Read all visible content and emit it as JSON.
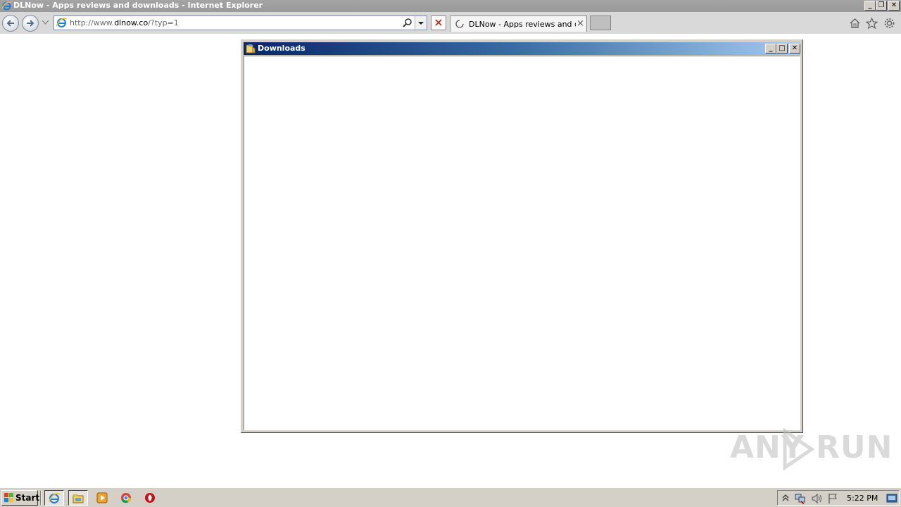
{
  "browser": {
    "window_title": "DLNow - Apps reviews and downloads - Internet Explorer",
    "address": {
      "prefix": "http://www.",
      "domain": "dlnow.co",
      "suffix": "/?typ=1"
    },
    "tab_title": "DLNow - Apps reviews and d...",
    "window_buttons": {
      "minimize": "_",
      "restore": "❐",
      "close": "✕"
    }
  },
  "dialog": {
    "title": "Downloads",
    "buttons": {
      "minimize": "_",
      "maximize": "□",
      "close": "✕"
    }
  },
  "watermark": {
    "left": "ANY",
    "right": "RUN"
  },
  "taskbar": {
    "start_label": "Start",
    "clock": "5:22 PM",
    "tray_icons": [
      "chevron-up-icon",
      "network-icon",
      "volume-icon",
      "flag-icon",
      "desktop-icon"
    ],
    "quick_launch": [
      "internet-explorer-icon",
      "explorer-folder-icon",
      "media-player-icon",
      "chrome-icon",
      "opera-icon"
    ]
  },
  "colors": {
    "dialog_title_start": "#0a246a",
    "dialog_title_end": "#a6caf0",
    "system_face": "#d4d0c8"
  }
}
